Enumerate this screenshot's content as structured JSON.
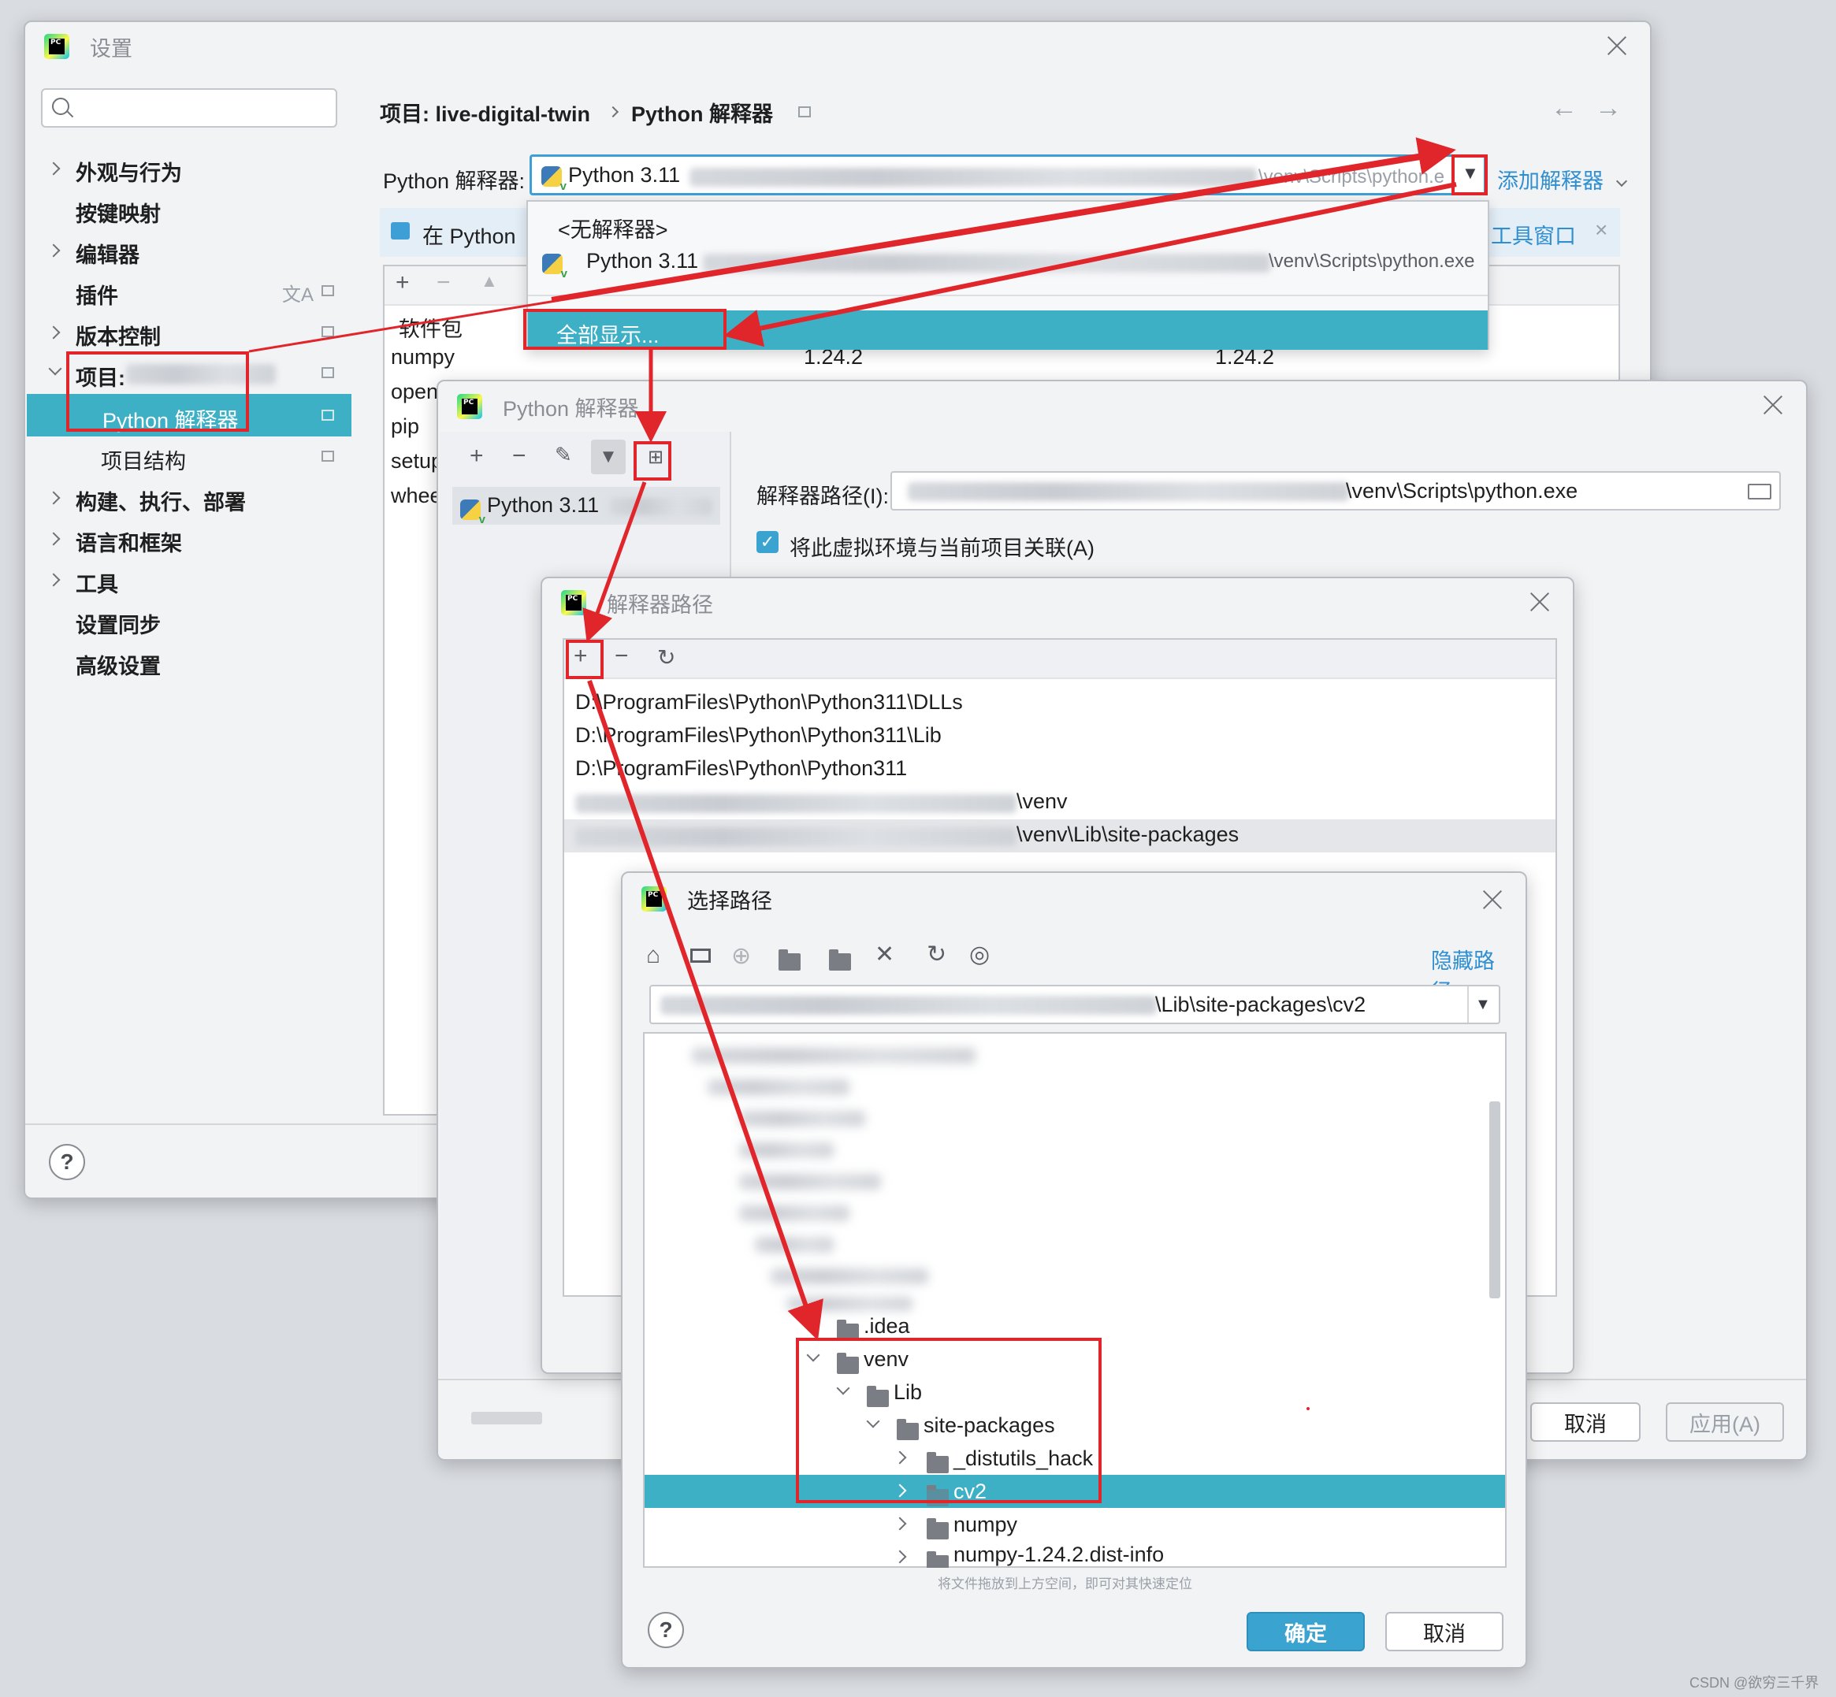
{
  "settings": {
    "title": "设置",
    "breadcrumb_project": "项目: live-digital-twin",
    "breadcrumb_page": "Python 解释器",
    "interpreter_label": "Python 解释器:",
    "interpreter_value": "Python 3.11",
    "interpreter_path_tail": "\\venv\\Scripts\\python.e",
    "add_interpreter": "添加解释器",
    "banner_text": "在 Python",
    "banner_link": "工具窗口",
    "package_header": "软件包",
    "packages": [
      {
        "name": "numpy",
        "version": "1.24.2",
        "latest": "1.24.2"
      },
      {
        "name": "open",
        "version": "",
        "latest": ""
      },
      {
        "name": "pip",
        "version": "",
        "latest": ""
      },
      {
        "name": "setup",
        "version": "",
        "latest": ""
      },
      {
        "name": "whee",
        "version": "",
        "latest": ""
      }
    ],
    "sidebar": [
      {
        "label": "外观与行为",
        "expand": true
      },
      {
        "label": "按键映射",
        "expand": false
      },
      {
        "label": "编辑器",
        "expand": true
      },
      {
        "label": "插件",
        "expand": false
      },
      {
        "label": "版本控制",
        "expand": true
      },
      {
        "label": "项目:",
        "expand": true
      },
      {
        "label": "Python 解释器",
        "expand": false
      },
      {
        "label": "项目结构",
        "expand": false
      },
      {
        "label": "构建、执行、部署",
        "expand": true
      },
      {
        "label": "语言和框架",
        "expand": true
      },
      {
        "label": "工具",
        "expand": true
      },
      {
        "label": "设置同步",
        "expand": false
      },
      {
        "label": "高级设置",
        "expand": false
      }
    ]
  },
  "dropdown": {
    "no_interpreter": "<无解释器>",
    "python_item": "Python 3.11",
    "python_item_path": "\\venv\\Scripts\\python.exe",
    "show_all": "全部显示..."
  },
  "interpreters_dialog": {
    "title": "Python 解释器",
    "list_item": "Python 3.11",
    "path_label": "解释器路径(I):",
    "path_value": "\\venv\\Scripts\\python.exe",
    "checkbox_label": "将此虚拟环境与当前项目关联(A)",
    "cancel": "取消",
    "apply": "应用(A)"
  },
  "paths_dialog": {
    "title": "解释器路径",
    "paths": [
      "D:\\ProgramFiles\\Python\\Python311\\DLLs",
      "D:\\ProgramFiles\\Python\\Python311\\Lib",
      "D:\\ProgramFiles\\Python\\Python311",
      "\\venv",
      "\\venv\\Lib\\site-packages"
    ]
  },
  "choose_dialog": {
    "title": "选择路径",
    "hide_path": "隐藏路径",
    "path_value": "\\Lib\\site-packages\\cv2",
    "tree": [
      {
        "label": ".idea",
        "indent": 0,
        "arrow": "",
        "selected": false
      },
      {
        "label": "venv",
        "indent": 0,
        "arrow": "down",
        "selected": false
      },
      {
        "label": "Lib",
        "indent": 1,
        "arrow": "down",
        "selected": false
      },
      {
        "label": "site-packages",
        "indent": 2,
        "arrow": "down",
        "selected": false
      },
      {
        "label": "_distutils_hack",
        "indent": 3,
        "arrow": "right",
        "selected": false
      },
      {
        "label": "cv2",
        "indent": 3,
        "arrow": "right",
        "selected": true
      },
      {
        "label": "numpy",
        "indent": 3,
        "arrow": "right",
        "selected": false
      },
      {
        "label": "numpy-1.24.2.dist-info",
        "indent": 3,
        "arrow": "right",
        "selected": false
      }
    ],
    "hint": "将文件拖放到上方空间，即可对其快速定位",
    "ok": "确定",
    "cancel": "取消"
  },
  "watermark": "CSDN @欲穷三千界",
  "colors": {
    "selection": "#3eb0c6",
    "annotation_red": "#e0252b",
    "link_blue": "#2f8fd0"
  }
}
